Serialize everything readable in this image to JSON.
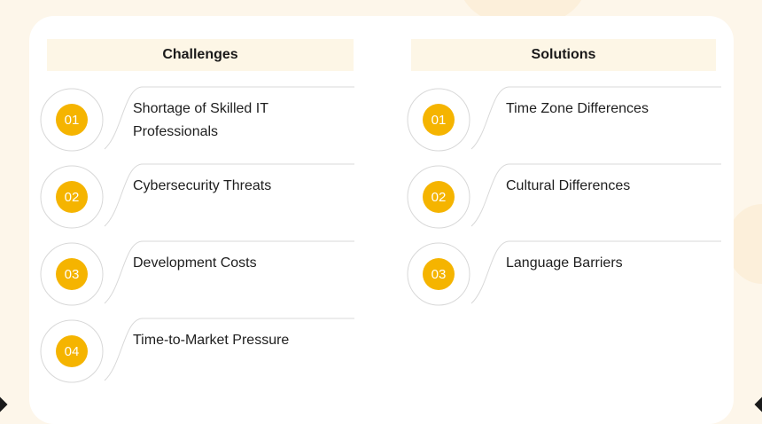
{
  "challenges": {
    "header": "Challenges",
    "items": [
      {
        "number": "01",
        "text": "Shortage of Skilled IT Professionals"
      },
      {
        "number": "02",
        "text": "Cybersecurity Threats"
      },
      {
        "number": "03",
        "text": "Development Costs"
      },
      {
        "number": "04",
        "text": "Time-to-Market Pressure"
      }
    ]
  },
  "solutions": {
    "header": "Solutions",
    "items": [
      {
        "number": "01",
        "text": "Time Zone Differences"
      },
      {
        "number": "02",
        "text": "Cultural Differences"
      },
      {
        "number": "03",
        "text": "Language Barriers"
      }
    ]
  },
  "colors": {
    "badge": "#f5b400",
    "header_bg": "#fdf6e6",
    "page_bg": "#fdf6ea"
  }
}
